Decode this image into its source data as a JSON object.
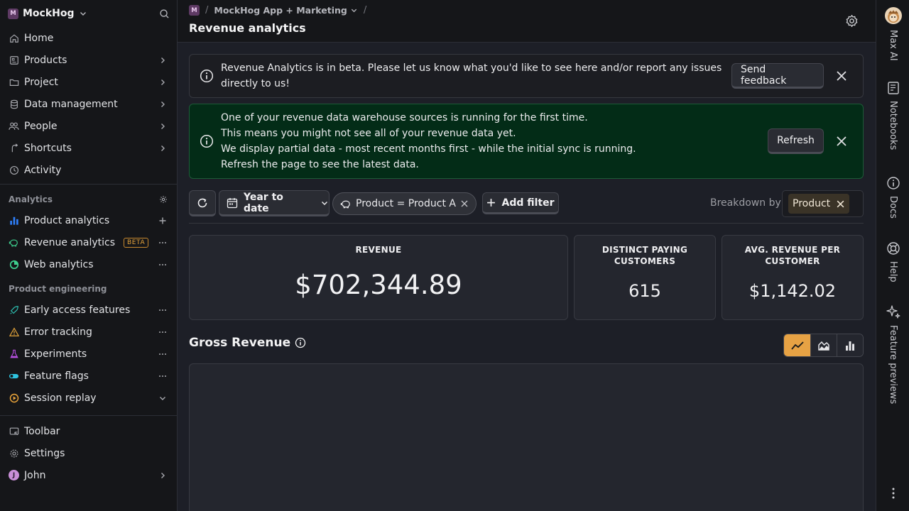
{
  "sidebar": {
    "org_badge": "M",
    "org_name": "MockHog",
    "nav": [
      {
        "label": "Home"
      },
      {
        "label": "Products"
      },
      {
        "label": "Project"
      },
      {
        "label": "Data management"
      },
      {
        "label": "People"
      },
      {
        "label": "Shortcuts"
      },
      {
        "label": "Activity"
      }
    ],
    "analytics_section": "Analytics",
    "analytics": [
      {
        "label": "Product analytics"
      },
      {
        "label": "Revenue analytics",
        "badge": "BETA"
      },
      {
        "label": "Web analytics"
      }
    ],
    "engineering_section": "Product engineering",
    "engineering": [
      {
        "label": "Early access features"
      },
      {
        "label": "Error tracking"
      },
      {
        "label": "Experiments"
      },
      {
        "label": "Feature flags"
      },
      {
        "label": "Session replay"
      }
    ],
    "bottom": [
      {
        "label": "Toolbar"
      },
      {
        "label": "Settings"
      },
      {
        "label": "John",
        "avatar": "J"
      }
    ]
  },
  "topbar": {
    "project_badge": "M",
    "project_name": "MockHog App + Marketing",
    "separator": "/",
    "title": "Revenue analytics"
  },
  "rail": {
    "items": [
      {
        "label": "Max AI"
      },
      {
        "label": "Notebooks"
      },
      {
        "label": "Docs"
      },
      {
        "label": "Help"
      },
      {
        "label": "Feature previews"
      }
    ]
  },
  "banners": {
    "beta": {
      "lines": [
        "Revenue Analytics is in beta. Please let us know what you'd like to see here and/or report any issues",
        "directly to us!"
      ],
      "button": "Send feedback"
    },
    "sync": {
      "lines": [
        "One of your revenue data warehouse sources is running for the first time.",
        "This means you might not see all of your revenue data yet.",
        "We display partial data - most recent months first - while the initial sync is running.",
        "Refresh the page to see the latest data."
      ],
      "button": "Refresh"
    }
  },
  "filters": {
    "date_range": "Year to date",
    "chip": "Product = Product A",
    "add_filter": "Add filter",
    "breakdown_label": "Breakdown by",
    "breakdown_value": "Product"
  },
  "kpis": [
    {
      "title": "REVENUE",
      "value": "$702,344.89"
    },
    {
      "title": "DISTINCT PAYING CUSTOMERS",
      "value": "615"
    },
    {
      "title": "AVG. REVENUE PER CUSTOMER",
      "value": "$1,142.02"
    }
  ],
  "gross_revenue": {
    "title": "Gross Revenue",
    "chart_types": [
      "line",
      "area",
      "bar"
    ],
    "selected": "line"
  },
  "colors": {
    "accent": "#e7a244",
    "green_banner": "#032c17",
    "beta_badge": "#e2a13a"
  }
}
